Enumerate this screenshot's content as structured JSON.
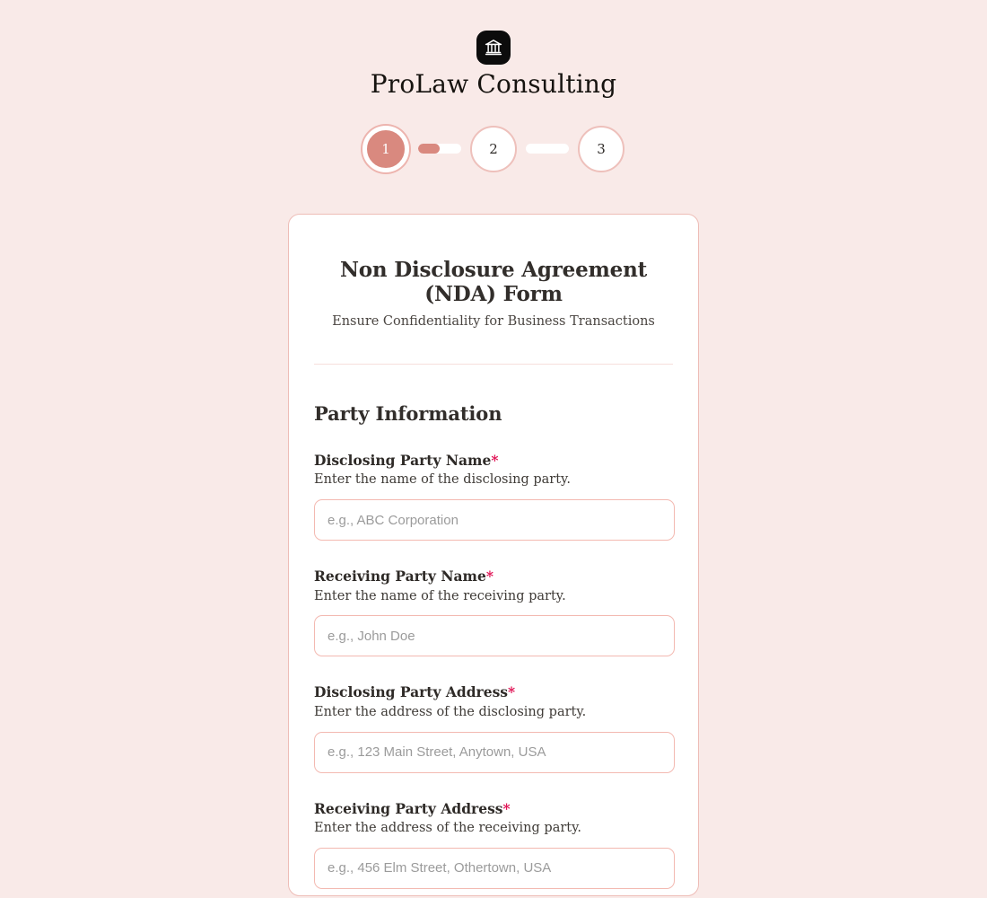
{
  "brand": {
    "name": "ProLaw Consulting",
    "logo_icon": "classical-bank-building-icon"
  },
  "stepper": {
    "steps": [
      {
        "label": "1",
        "state": "active"
      },
      {
        "label": "2",
        "state": "upcoming"
      },
      {
        "label": "3",
        "state": "upcoming"
      }
    ],
    "connectors": [
      {
        "fill_percent": 50
      },
      {
        "fill_percent": 0
      }
    ],
    "active_color": "#d9897f",
    "inactive_color": "#ffffff",
    "border_color": "#eec0bb"
  },
  "form": {
    "title": "Non Disclosure Agreement (NDA) Form",
    "subtitle": "Ensure Confidentiality for Business Transactions",
    "section_heading": "Party Information",
    "required_marker": "*",
    "fields": [
      {
        "label": "Disclosing Party Name",
        "required": true,
        "help": "Enter the name of the disclosing party.",
        "placeholder": "e.g., ABC Corporation",
        "value": ""
      },
      {
        "label": "Receiving Party Name",
        "required": true,
        "help": "Enter the name of the receiving party.",
        "placeholder": "e.g., John Doe",
        "value": ""
      },
      {
        "label": "Disclosing Party Address",
        "required": true,
        "help": "Enter the address of the disclosing party.",
        "placeholder": "e.g., 123 Main Street, Anytown, USA",
        "value": ""
      },
      {
        "label": "Receiving Party Address",
        "required": true,
        "help": "Enter the address of the receiving party.",
        "placeholder": "e.g., 456 Elm Street, Othertown, USA",
        "value": ""
      }
    ]
  },
  "colors": {
    "page_background": "#f9eae8",
    "card_background": "#ffffff",
    "card_border": "#eebdb7",
    "accent": "#d9897f",
    "input_border": "#f3b9b1",
    "required_asterisk": "#e01254",
    "logo_background": "#0c0c0c"
  }
}
